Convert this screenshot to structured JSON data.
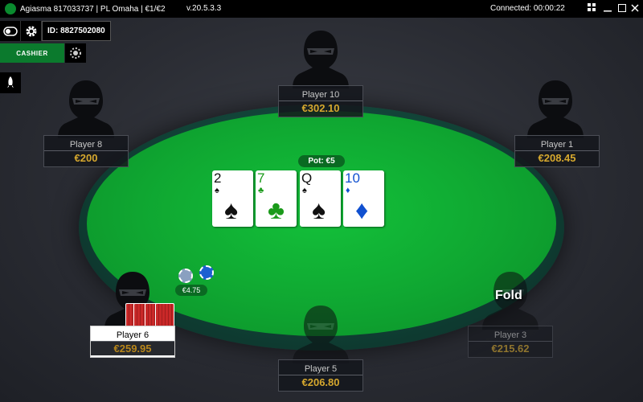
{
  "titlebar": {
    "title": "Agiasma 817033737 | PL Omaha | €1/€2",
    "version": "v.20.5.3.3",
    "connection": "Connected: 00:00:22"
  },
  "toolbar": {
    "player_id": "ID: 8827502080",
    "cashier_label": "CASHIER"
  },
  "table": {
    "pot": "Pot: €5",
    "board": [
      {
        "rank": "2",
        "suit": "♠",
        "color": "#111111"
      },
      {
        "rank": "7",
        "suit": "♣",
        "color": "#1a9a1a"
      },
      {
        "rank": "Q",
        "suit": "♠",
        "color": "#111111"
      },
      {
        "rank": "10",
        "suit": "♦",
        "color": "#1050d0"
      }
    ],
    "bet": "€4.75"
  },
  "players": {
    "p10": {
      "name": "Player 10",
      "stack": "€302.10"
    },
    "p8": {
      "name": "Player 8",
      "stack": "€200"
    },
    "p1": {
      "name": "Player 1",
      "stack": "€208.45"
    },
    "p6": {
      "name": "Player 6",
      "stack": "€259.95"
    },
    "p5": {
      "name": "Player 5",
      "stack": "€206.80"
    },
    "p3": {
      "name": "Player 3",
      "stack": "€215.62",
      "status": "Fold"
    }
  },
  "colors": {
    "felt": "#0fa631",
    "stack_gold": "#d6a82e",
    "cashier_green": "#0b7a2d"
  }
}
